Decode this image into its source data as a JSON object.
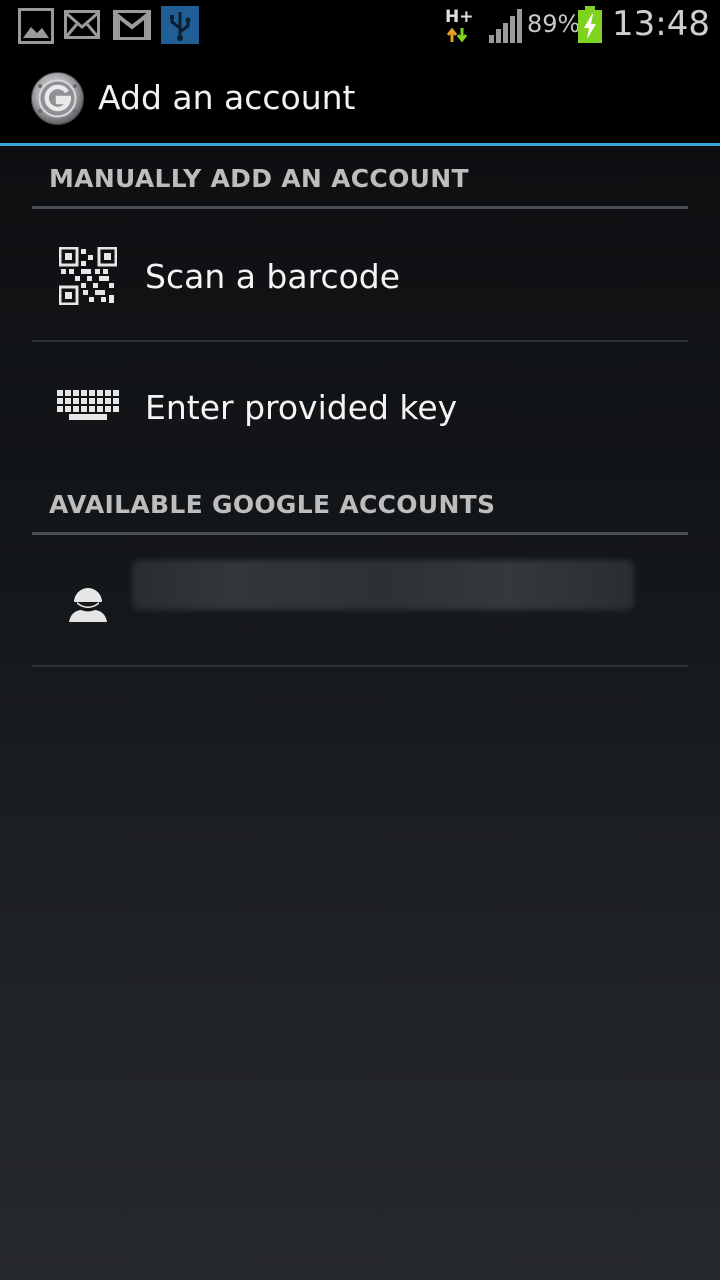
{
  "status_bar": {
    "network_type": "H+",
    "battery_percent": "89%",
    "time": "13:48",
    "notification_icons": [
      "gallery-icon",
      "email-icon",
      "gmail-icon",
      "usb-icon"
    ]
  },
  "action_bar": {
    "title": "Add an account",
    "app_icon": "authenticator-icon"
  },
  "sections": {
    "manual": {
      "header": "MANUALLY ADD AN ACCOUNT",
      "items": [
        {
          "label": "Scan a barcode",
          "icon": "qr-code-icon"
        },
        {
          "label": "Enter provided key",
          "icon": "keyboard-icon"
        }
      ]
    },
    "google": {
      "header": "AVAILABLE GOOGLE ACCOUNTS",
      "items": [
        {
          "label": "",
          "icon": "person-icon",
          "redacted": true
        }
      ]
    }
  },
  "colors": {
    "accent": "#35a8d8",
    "battery": "#7fd320",
    "header_text": "#bdbdbd",
    "item_text": "#f4f4f4"
  }
}
